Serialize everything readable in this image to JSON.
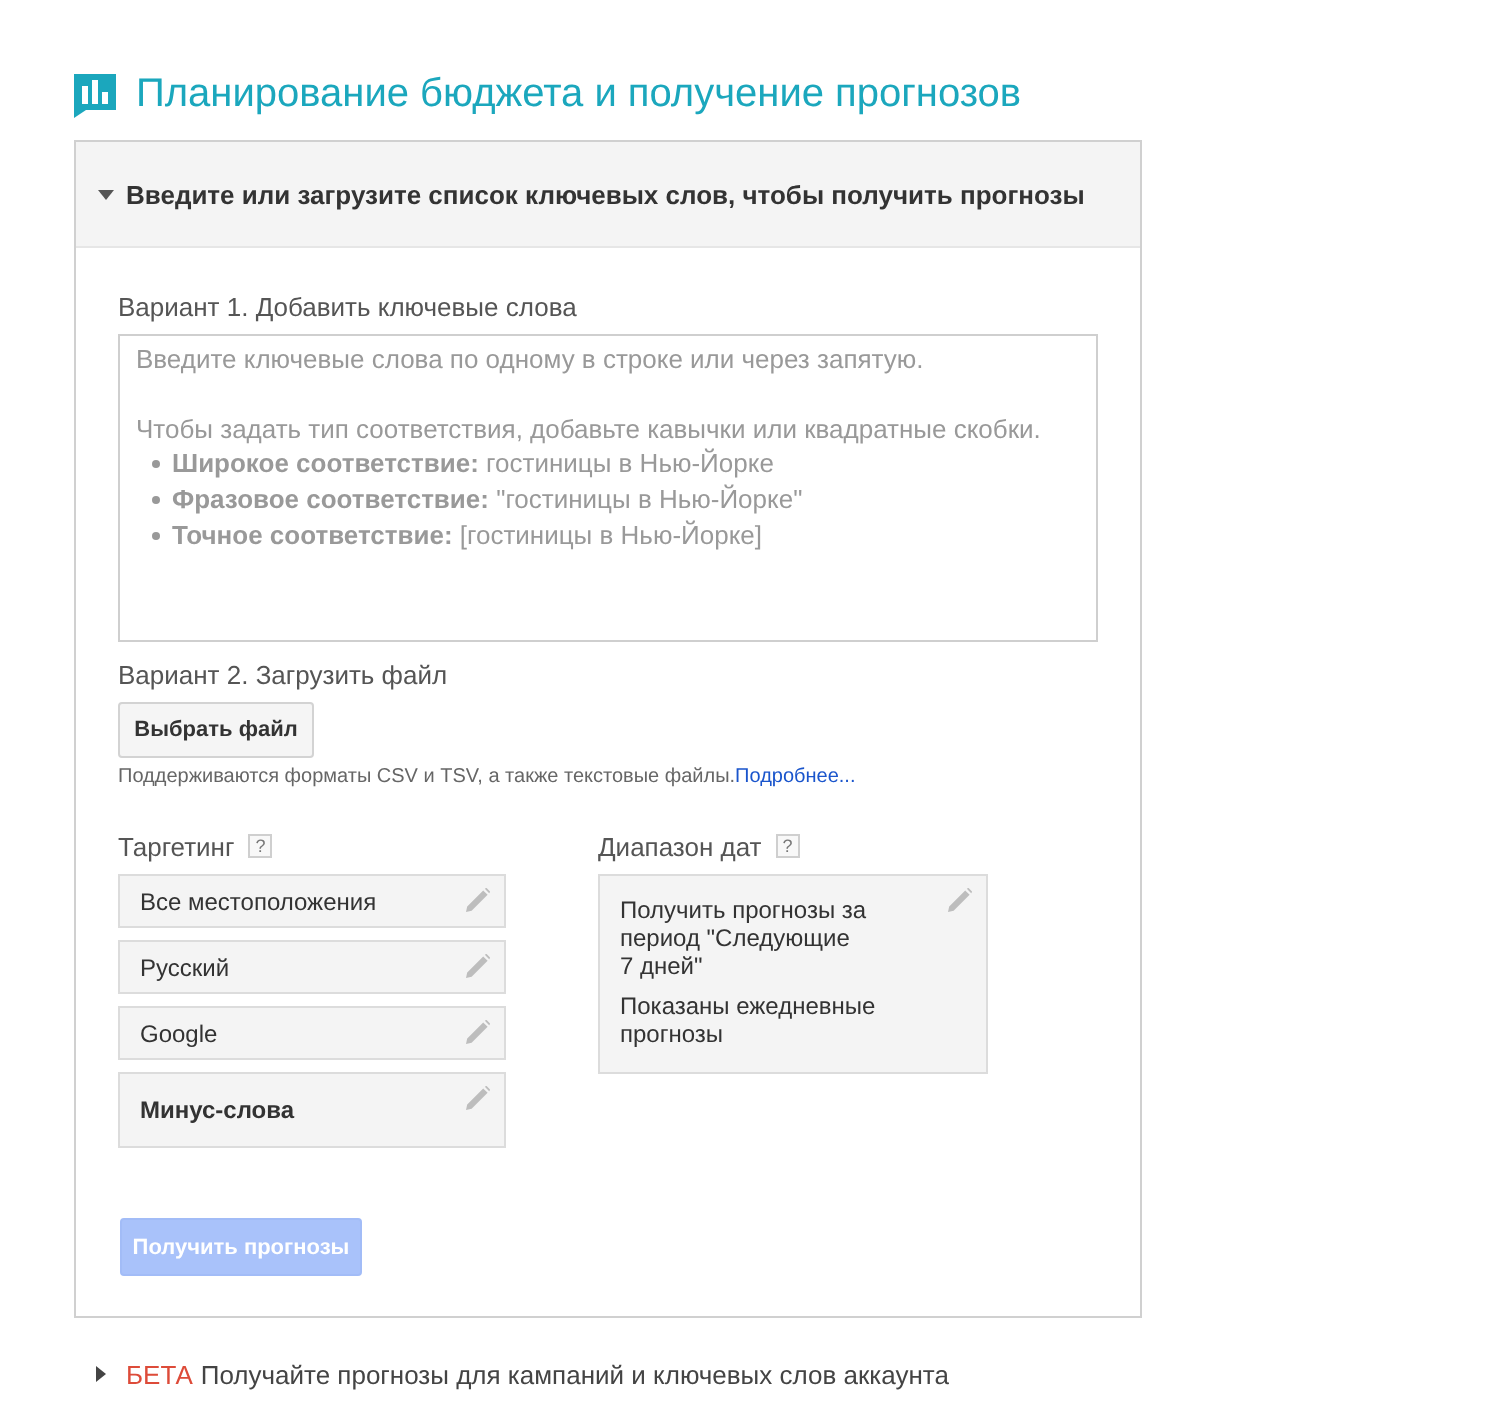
{
  "title": {
    "text": "Планирование бюджета и получение прогнозов"
  },
  "panel": {
    "header": {
      "text": "Введите или загрузите список ключевых слов, чтобы получить прогнозы",
      "expanded": true
    },
    "option_1": {
      "label": "Вариант 1. Добавить ключевые слова",
      "placeholder": {
        "intro": "Введите ключевые слова по одному в строке или через запятую.",
        "hint": "Чтобы задать тип соответствия, добавьте кавычки или квадратные скобки.",
        "examples": [
          {
            "text": "**Широкое соответствие:** гостиницы в Нью-Йорке"
          },
          {
            "text": "**Фразовое соответствие:** \"гостиницы в Нью-Йорке\""
          },
          {
            "text": "**Точное соответствие:** [гостиницы в Нью-Йорке]"
          }
        ]
      }
    },
    "option_2": {
      "label": "Вариант 2. Загрузить файл",
      "button": "Выбрать файл",
      "note": "Поддерживаются форматы CSV и TSV, а также текстовые файлы.",
      "note_link": "Подробнее..."
    },
    "targeting": {
      "label": "Таргетинг",
      "help": "?",
      "items": [
        {
          "kind": "setting",
          "text": "Все местоположения"
        },
        {
          "kind": "setting",
          "text": "Русский"
        },
        {
          "kind": "setting",
          "text": "Google"
        },
        {
          "kind": "negative",
          "text": "Минус-слова"
        }
      ]
    },
    "date_range": {
      "label": "Диапазон дат",
      "help": "?",
      "lines": [
        "Получить прогнозы за период \"Следующие 7 дней\"",
        "Показаны ежедневные прогнозы"
      ]
    },
    "submit": {
      "label": "Получить прогнозы",
      "disabled": true
    }
  },
  "footer": {
    "expanded": false,
    "badge": "БЕТА",
    "text": "Получайте прогнозы для кампаний и ключевых слов аккаунта"
  }
}
